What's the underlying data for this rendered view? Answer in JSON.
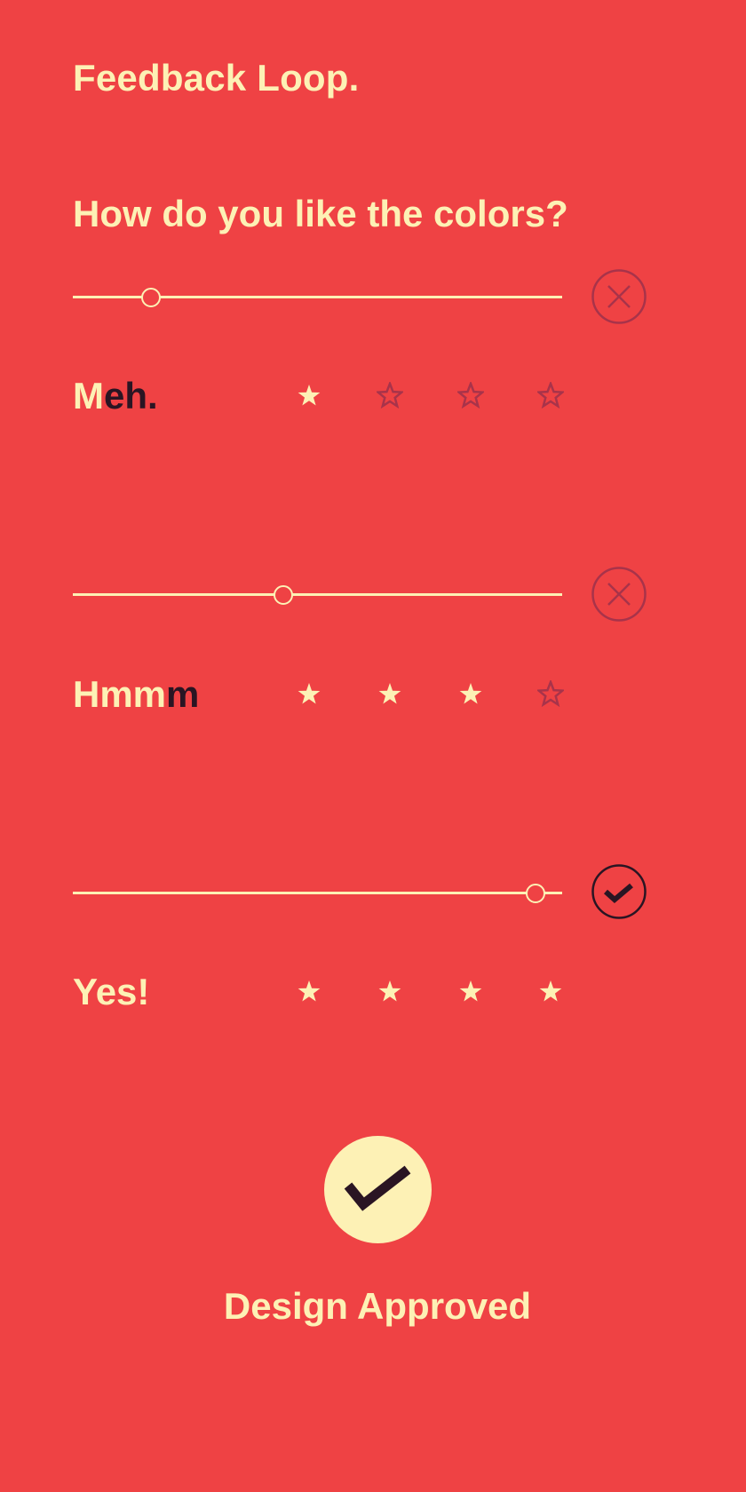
{
  "app": {
    "title": "Feedback Loop."
  },
  "question": "How do you like the colors?",
  "ratings": [
    {
      "label_light": "M",
      "label_dark": "eh.",
      "slider_value": 0.16,
      "stars": 1,
      "max_stars": 4,
      "status": "rejected",
      "status_icon": "close-circle-icon"
    },
    {
      "label_light": "Hmm",
      "label_dark": "m",
      "slider_value": 0.43,
      "stars": 3,
      "max_stars": 4,
      "status": "rejected",
      "status_icon": "close-circle-icon"
    },
    {
      "label_light": "Yes!",
      "label_dark": "",
      "slider_value": 0.945,
      "stars": 4,
      "max_stars": 4,
      "status": "approved",
      "status_icon": "check-circle-icon"
    }
  ],
  "approve": {
    "label": "Design Approved",
    "icon": "checkmark-icon"
  },
  "colors": {
    "background": "#EF4244",
    "accent": "#FDF1B5",
    "dark": "#2A1523",
    "muted": "#A8334A"
  }
}
